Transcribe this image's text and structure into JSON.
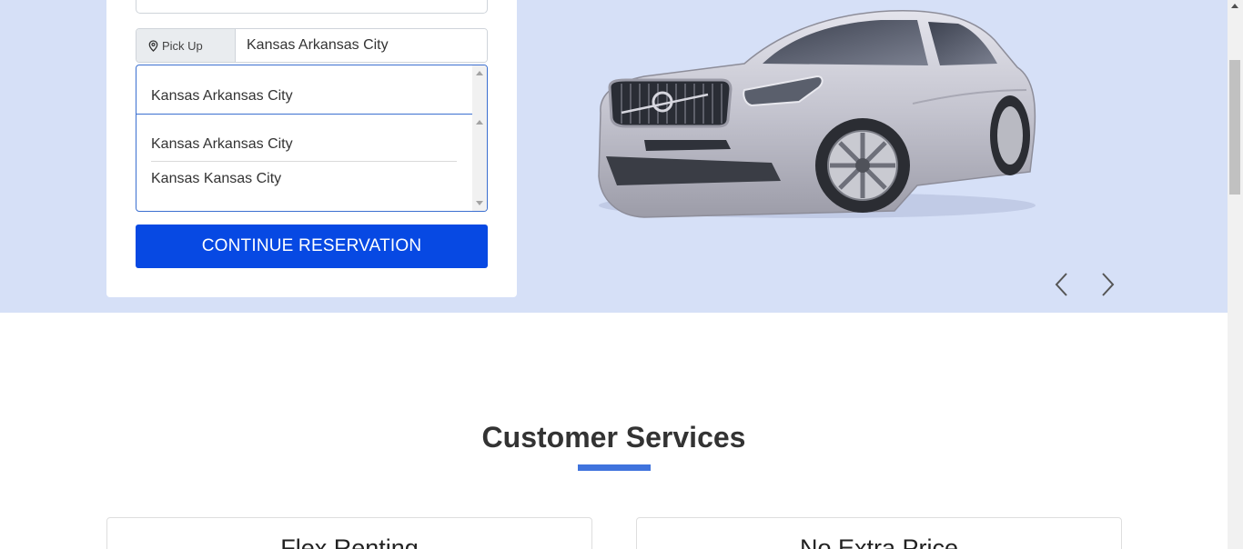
{
  "reservation": {
    "pickup_label": "Pick Up",
    "pickup_value": "Kansas Arkansas City",
    "selected_option": "Kansas Arkansas City",
    "options": [
      "Kansas Arkansas City",
      "Kansas Kansas City"
    ],
    "continue_label": "CONTINUE RESERVATION"
  },
  "hero": {
    "image": "silver-volvo-sedan",
    "prev_icon": "chevron-left-icon",
    "next_icon": "chevron-right-icon"
  },
  "services": {
    "title": "Customer Services",
    "cards": [
      {
        "title": "Flex Renting"
      },
      {
        "title": "No Extra Price"
      }
    ]
  },
  "colors": {
    "hero_bg": "#d6e0f7",
    "primary": "#0749e3",
    "accent": "#3f73dd"
  }
}
